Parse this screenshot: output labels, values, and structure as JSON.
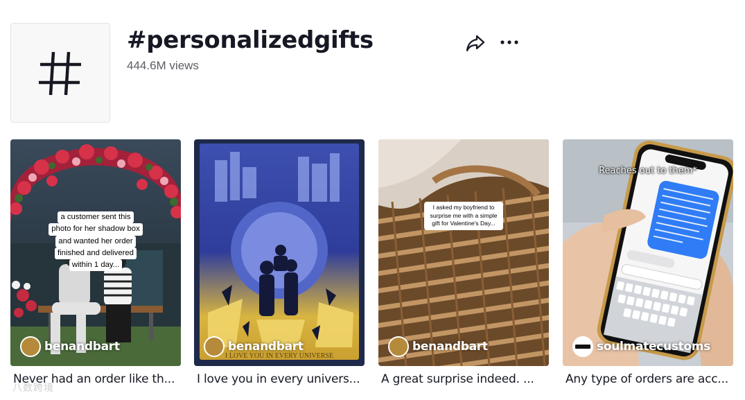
{
  "header": {
    "hashtag_icon": "hash-icon",
    "title": "#personalizedgifts",
    "views": "444.6M views",
    "share_icon": "share-icon",
    "more_icon": "more-icon"
  },
  "videos": [
    {
      "overlay_text": "a customer sent this photo for her shadow box and wanted her order finished and delivered within 1 day...",
      "overlay_lines": [
        "a customer sent this",
        "photo for her shadow box",
        "and wanted her order",
        "finished and delivered",
        "within 1 day..."
      ],
      "author": "benandbart",
      "caption": "Never had an order like th..."
    },
    {
      "overlay_text": "I LOVE YOU IN EVERY UNIVERSE",
      "author": "benandbart",
      "caption": "I love you in every univers..."
    },
    {
      "overlay_lines": [
        "I asked my boyfriend to",
        "surprise me with a simple",
        "gift for Valentine's Day..."
      ],
      "author": "benandbart",
      "caption": "A great surprise indeed. ..."
    },
    {
      "overlay_text": "Reaches out to them*",
      "author": "soulmatecustoms",
      "caption": "Any type of orders are acc..."
    }
  ],
  "watermark": "八数跨境",
  "colors": {
    "text_primary": "#161823",
    "text_secondary": "#5c5d63",
    "avatar_bg": "#f8f8f8"
  }
}
